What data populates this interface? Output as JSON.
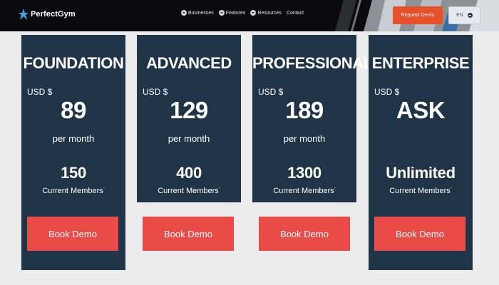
{
  "header": {
    "logo_text": "PerfectGym",
    "nav": [
      {
        "label": "Businesses"
      },
      {
        "label": "Features"
      },
      {
        "label": "Resources"
      },
      {
        "label": "Contact"
      }
    ],
    "request_demo": "Request Demo",
    "language": "EN"
  },
  "plans": [
    {
      "name": "FOUNDATION",
      "currency": "USD $",
      "price": "89",
      "period": "per month",
      "members": "150",
      "members_label": "Current Members",
      "members_note": "*",
      "cta": "Book Demo"
    },
    {
      "name": "ADVANCED",
      "currency": "USD $",
      "price": "129",
      "period": "per month",
      "members": "400",
      "members_label": "Current Members",
      "members_note": "*",
      "cta": "Book Demo"
    },
    {
      "name": "PROFESSIONAL",
      "currency": "USD $",
      "price": "189",
      "period": "per month",
      "members": "1300",
      "members_label": "Current Members",
      "members_note": "*",
      "cta": "Book Demo"
    },
    {
      "name": "ENTERPRISE",
      "currency": "USD $",
      "price": "ASK",
      "period": "",
      "members": "Unlimited",
      "members_label": "Current Members",
      "members_note": "*",
      "cta": "Book Demo"
    }
  ],
  "colors": {
    "card_bg": "#203448",
    "cta_bg": "#eb4b46",
    "request_demo_bg": "#e8502a",
    "header_bg": "#0b0b0d"
  }
}
